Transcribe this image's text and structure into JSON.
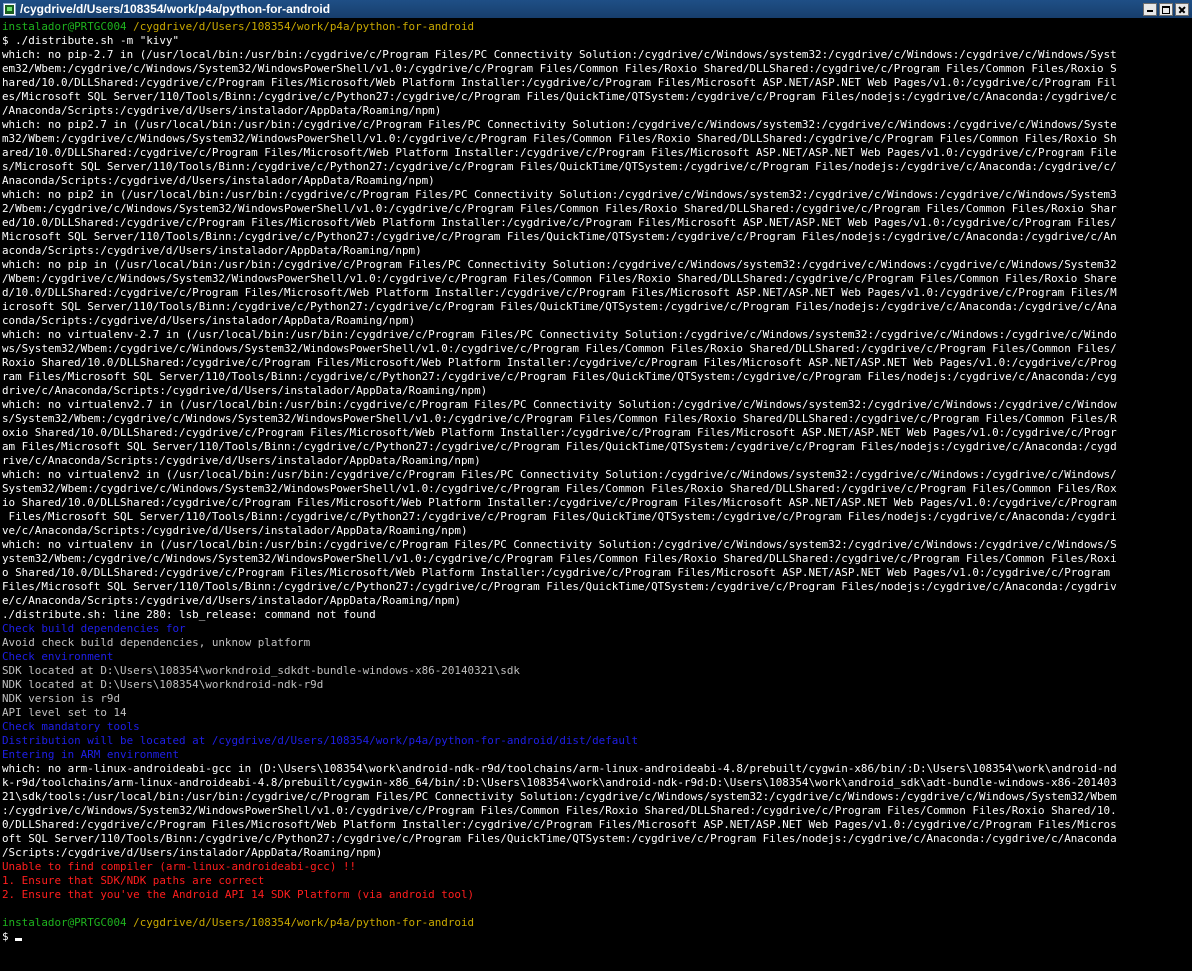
{
  "window": {
    "title": "/cygdrive/d/Users/108354/work/p4a/python-for-android"
  },
  "prompt": {
    "user_host": "instalador@PRTGC004",
    "path": "/cygdrive/d/Users/108354/work/p4a/python-for-android",
    "symbol": "$"
  },
  "colors": {
    "normal": "#ffffff",
    "dim": "#c0c0c0",
    "blue": "#1f1fe8",
    "red": "#ff1e1e",
    "green": "#1eb31e",
    "yellow": "#c8a800"
  },
  "terminal": {
    "lines": [
      {
        "t": "normal",
        "text": "$ ./distribute.sh -m \"kivy\""
      },
      {
        "t": "normal",
        "text": "which: no pip-2.7 in (/usr/local/bin:/usr/bin:/cygdrive/c/Program Files/PC Connectivity Solution:/cygdrive/c/Windows/system32:/cygdrive/c/Windows:/cygdrive/c/Windows/Syst"
      },
      {
        "t": "normal",
        "text": "em32/Wbem:/cygdrive/c/Windows/System32/WindowsPowerShell/v1.0:/cygdrive/c/Program Files/Common Files/Roxio Shared/DLLShared:/cygdrive/c/Program Files/Common Files/Roxio S"
      },
      {
        "t": "normal",
        "text": "hared/10.0/DLLShared:/cygdrive/c/Program Files/Microsoft/Web Platform Installer:/cygdrive/c/Program Files/Microsoft ASP.NET/ASP.NET Web Pages/v1.0:/cygdrive/c/Program Fil"
      },
      {
        "t": "normal",
        "text": "es/Microsoft SQL Server/110/Tools/Binn:/cygdrive/c/Python27:/cygdrive/c/Program Files/QuickTime/QTSystem:/cygdrive/c/Program Files/nodejs:/cygdrive/c/Anaconda:/cygdrive/c"
      },
      {
        "t": "normal",
        "text": "/Anaconda/Scripts:/cygdrive/d/Users/instalador/AppData/Roaming/npm)"
      },
      {
        "t": "normal",
        "text": "which: no pip2.7 in (/usr/local/bin:/usr/bin:/cygdrive/c/Program Files/PC Connectivity Solution:/cygdrive/c/Windows/system32:/cygdrive/c/Windows:/cygdrive/c/Windows/Syste"
      },
      {
        "t": "normal",
        "text": "m32/Wbem:/cygdrive/c/Windows/System32/WindowsPowerShell/v1.0:/cygdrive/c/Program Files/Common Files/Roxio Shared/DLLShared:/cygdrive/c/Program Files/Common Files/Roxio Sh"
      },
      {
        "t": "normal",
        "text": "ared/10.0/DLLShared:/cygdrive/c/Program Files/Microsoft/Web Platform Installer:/cygdrive/c/Program Files/Microsoft ASP.NET/ASP.NET Web Pages/v1.0:/cygdrive/c/Program File"
      },
      {
        "t": "normal",
        "text": "s/Microsoft SQL Server/110/Tools/Binn:/cygdrive/c/Python27:/cygdrive/c/Program Files/QuickTime/QTSystem:/cygdrive/c/Program Files/nodejs:/cygdrive/c/Anaconda:/cygdrive/c/"
      },
      {
        "t": "normal",
        "text": "Anaconda/Scripts:/cygdrive/d/Users/instalador/AppData/Roaming/npm)"
      },
      {
        "t": "normal",
        "text": "which: no pip2 in (/usr/local/bin:/usr/bin:/cygdrive/c/Program Files/PC Connectivity Solution:/cygdrive/c/Windows/system32:/cygdrive/c/Windows:/cygdrive/c/Windows/System3"
      },
      {
        "t": "normal",
        "text": "2/Wbem:/cygdrive/c/Windows/System32/WindowsPowerShell/v1.0:/cygdrive/c/Program Files/Common Files/Roxio Shared/DLLShared:/cygdrive/c/Program Files/Common Files/Roxio Shar"
      },
      {
        "t": "normal",
        "text": "ed/10.0/DLLShared:/cygdrive/c/Program Files/Microsoft/Web Platform Installer:/cygdrive/c/Program Files/Microsoft ASP.NET/ASP.NET Web Pages/v1.0:/cygdrive/c/Program Files/"
      },
      {
        "t": "normal",
        "text": "Microsoft SQL Server/110/Tools/Binn:/cygdrive/c/Python27:/cygdrive/c/Program Files/QuickTime/QTSystem:/cygdrive/c/Program Files/nodejs:/cygdrive/c/Anaconda:/cygdrive/c/An"
      },
      {
        "t": "normal",
        "text": "aconda/Scripts:/cygdrive/d/Users/instalador/AppData/Roaming/npm)"
      },
      {
        "t": "normal",
        "text": "which: no pip in (/usr/local/bin:/usr/bin:/cygdrive/c/Program Files/PC Connectivity Solution:/cygdrive/c/Windows/system32:/cygdrive/c/Windows:/cygdrive/c/Windows/System32"
      },
      {
        "t": "normal",
        "text": "/Wbem:/cygdrive/c/Windows/System32/WindowsPowerShell/v1.0:/cygdrive/c/Program Files/Common Files/Roxio Shared/DLLShared:/cygdrive/c/Program Files/Common Files/Roxio Share"
      },
      {
        "t": "normal",
        "text": "d/10.0/DLLShared:/cygdrive/c/Program Files/Microsoft/Web Platform Installer:/cygdrive/c/Program Files/Microsoft ASP.NET/ASP.NET Web Pages/v1.0:/cygdrive/c/Program Files/M"
      },
      {
        "t": "normal",
        "text": "icrosoft SQL Server/110/Tools/Binn:/cygdrive/c/Python27:/cygdrive/c/Program Files/QuickTime/QTSystem:/cygdrive/c/Program Files/nodejs:/cygdrive/c/Anaconda:/cygdrive/c/Ana"
      },
      {
        "t": "normal",
        "text": "conda/Scripts:/cygdrive/d/Users/instalador/AppData/Roaming/npm)"
      },
      {
        "t": "normal",
        "text": "which: no virtualenv-2.7 in (/usr/local/bin:/usr/bin:/cygdrive/c/Program Files/PC Connectivity Solution:/cygdrive/c/Windows/system32:/cygdrive/c/Windows:/cygdrive/c/Windo"
      },
      {
        "t": "normal",
        "text": "ws/System32/Wbem:/cygdrive/c/Windows/System32/WindowsPowerShell/v1.0:/cygdrive/c/Program Files/Common Files/Roxio Shared/DLLShared:/cygdrive/c/Program Files/Common Files/"
      },
      {
        "t": "normal",
        "text": "Roxio Shared/10.0/DLLShared:/cygdrive/c/Program Files/Microsoft/Web Platform Installer:/cygdrive/c/Program Files/Microsoft ASP.NET/ASP.NET Web Pages/v1.0:/cygdrive/c/Prog"
      },
      {
        "t": "normal",
        "text": "ram Files/Microsoft SQL Server/110/Tools/Binn:/cygdrive/c/Python27:/cygdrive/c/Program Files/QuickTime/QTSystem:/cygdrive/c/Program Files/nodejs:/cygdrive/c/Anaconda:/cyg"
      },
      {
        "t": "normal",
        "text": "drive/c/Anaconda/Scripts:/cygdrive/d/Users/instalador/AppData/Roaming/npm)"
      },
      {
        "t": "normal",
        "text": "which: no virtualenv2.7 in (/usr/local/bin:/usr/bin:/cygdrive/c/Program Files/PC Connectivity Solution:/cygdrive/c/Windows/system32:/cygdrive/c/Windows:/cygdrive/c/Window"
      },
      {
        "t": "normal",
        "text": "s/System32/Wbem:/cygdrive/c/Windows/System32/WindowsPowerShell/v1.0:/cygdrive/c/Program Files/Common Files/Roxio Shared/DLLShared:/cygdrive/c/Program Files/Common Files/R"
      },
      {
        "t": "normal",
        "text": "oxio Shared/10.0/DLLShared:/cygdrive/c/Program Files/Microsoft/Web Platform Installer:/cygdrive/c/Program Files/Microsoft ASP.NET/ASP.NET Web Pages/v1.0:/cygdrive/c/Progr"
      },
      {
        "t": "normal",
        "text": "am Files/Microsoft SQL Server/110/Tools/Binn:/cygdrive/c/Python27:/cygdrive/c/Program Files/QuickTime/QTSystem:/cygdrive/c/Program Files/nodejs:/cygdrive/c/Anaconda:/cygd"
      },
      {
        "t": "normal",
        "text": "rive/c/Anaconda/Scripts:/cygdrive/d/Users/instalador/AppData/Roaming/npm)"
      },
      {
        "t": "normal",
        "text": "which: no virtualenv2 in (/usr/local/bin:/usr/bin:/cygdrive/c/Program Files/PC Connectivity Solution:/cygdrive/c/Windows/system32:/cygdrive/c/Windows:/cygdrive/c/Windows/"
      },
      {
        "t": "normal",
        "text": "System32/Wbem:/cygdrive/c/Windows/System32/WindowsPowerShell/v1.0:/cygdrive/c/Program Files/Common Files/Roxio Shared/DLLShared:/cygdrive/c/Program Files/Common Files/Rox"
      },
      {
        "t": "normal",
        "text": "io Shared/10.0/DLLShared:/cygdrive/c/Program Files/Microsoft/Web Platform Installer:/cygdrive/c/Program Files/Microsoft ASP.NET/ASP.NET Web Pages/v1.0:/cygdrive/c/Program"
      },
      {
        "t": "normal",
        "text": " Files/Microsoft SQL Server/110/Tools/Binn:/cygdrive/c/Python27:/cygdrive/c/Program Files/QuickTime/QTSystem:/cygdrive/c/Program Files/nodejs:/cygdrive/c/Anaconda:/cygdri"
      },
      {
        "t": "normal",
        "text": "ve/c/Anaconda/Scripts:/cygdrive/d/Users/instalador/AppData/Roaming/npm)"
      },
      {
        "t": "normal",
        "text": "which: no virtualenv in (/usr/local/bin:/usr/bin:/cygdrive/c/Program Files/PC Connectivity Solution:/cygdrive/c/Windows/system32:/cygdrive/c/Windows:/cygdrive/c/Windows/S"
      },
      {
        "t": "normal",
        "text": "ystem32/Wbem:/cygdrive/c/Windows/System32/WindowsPowerShell/v1.0:/cygdrive/c/Program Files/Common Files/Roxio Shared/DLLShared:/cygdrive/c/Program Files/Common Files/Roxi"
      },
      {
        "t": "normal",
        "text": "o Shared/10.0/DLLShared:/cygdrive/c/Program Files/Microsoft/Web Platform Installer:/cygdrive/c/Program Files/Microsoft ASP.NET/ASP.NET Web Pages/v1.0:/cygdrive/c/Program "
      },
      {
        "t": "normal",
        "text": "Files/Microsoft SQL Server/110/Tools/Binn:/cygdrive/c/Python27:/cygdrive/c/Program Files/QuickTime/QTSystem:/cygdrive/c/Program Files/nodejs:/cygdrive/c/Anaconda:/cygdriv"
      },
      {
        "t": "normal",
        "text": "e/c/Anaconda/Scripts:/cygdrive/d/Users/instalador/AppData/Roaming/npm)"
      },
      {
        "t": "normal",
        "text": "./distribute.sh: line 280: lsb_release: command not found"
      },
      {
        "t": "blue",
        "text": "Check build dependencies for"
      },
      {
        "t": "dim",
        "text": "Avoid check build dependencies, unknow platform"
      },
      {
        "t": "blue",
        "text": "Check environment"
      },
      {
        "t": "dim",
        "text": "SDK located at D:\\Users\\108354\\workndroid_sdkdt-bundle-windows-x86-20140321\\sdk"
      },
      {
        "t": "dim",
        "text": "NDK located at D:\\Users\\108354\\workndroid-ndk-r9d"
      },
      {
        "t": "dim",
        "text": "NDK version is r9d"
      },
      {
        "t": "dim",
        "text": "API level set to 14"
      },
      {
        "t": "blue",
        "text": "Check mandatory tools"
      },
      {
        "t": "blue",
        "text": "Distribution will be located at /cygdrive/d/Users/108354/work/p4a/python-for-android/dist/default"
      },
      {
        "t": "blue",
        "text": "Entering in ARM environment"
      },
      {
        "t": "normal",
        "text": "which: no arm-linux-androideabi-gcc in (D:\\Users\\108354\\work\\android-ndk-r9d/toolchains/arm-linux-androideabi-4.8/prebuilt/cygwin-x86/bin/:D:\\Users\\108354\\work\\android-nd"
      },
      {
        "t": "normal",
        "text": "k-r9d/toolchains/arm-linux-androideabi-4.8/prebuilt/cygwin-x86_64/bin/:D:\\Users\\108354\\work\\android-ndk-r9d:D:\\Users\\108354\\work\\android_sdk\\adt-bundle-windows-x86-201403"
      },
      {
        "t": "normal",
        "text": "21\\sdk/tools:/usr/local/bin:/usr/bin:/cygdrive/c/Program Files/PC Connectivity Solution:/cygdrive/c/Windows/system32:/cygdrive/c/Windows:/cygdrive/c/Windows/System32/Wbem"
      },
      {
        "t": "normal",
        "text": ":/cygdrive/c/Windows/System32/WindowsPowerShell/v1.0:/cygdrive/c/Program Files/Common Files/Roxio Shared/DLLShared:/cygdrive/c/Program Files/Common Files/Roxio Shared/10."
      },
      {
        "t": "normal",
        "text": "0/DLLShared:/cygdrive/c/Program Files/Microsoft/Web Platform Installer:/cygdrive/c/Program Files/Microsoft ASP.NET/ASP.NET Web Pages/v1.0:/cygdrive/c/Program Files/Micros"
      },
      {
        "t": "normal",
        "text": "oft SQL Server/110/Tools/Binn:/cygdrive/c/Python27:/cygdrive/c/Program Files/QuickTime/QTSystem:/cygdrive/c/Program Files/nodejs:/cygdrive/c/Anaconda:/cygdrive/c/Anaconda"
      },
      {
        "t": "normal",
        "text": "/Scripts:/cygdrive/d/Users/instalador/AppData/Roaming/npm)"
      },
      {
        "t": "red",
        "text": "Unable to find compiler (arm-linux-androideabi-gcc) !!"
      },
      {
        "t": "red",
        "text": "1. Ensure that SDK/NDK paths are correct"
      },
      {
        "t": "red",
        "text": "2. Ensure that you've the Android API 14 SDK Platform (via android tool)"
      }
    ]
  }
}
